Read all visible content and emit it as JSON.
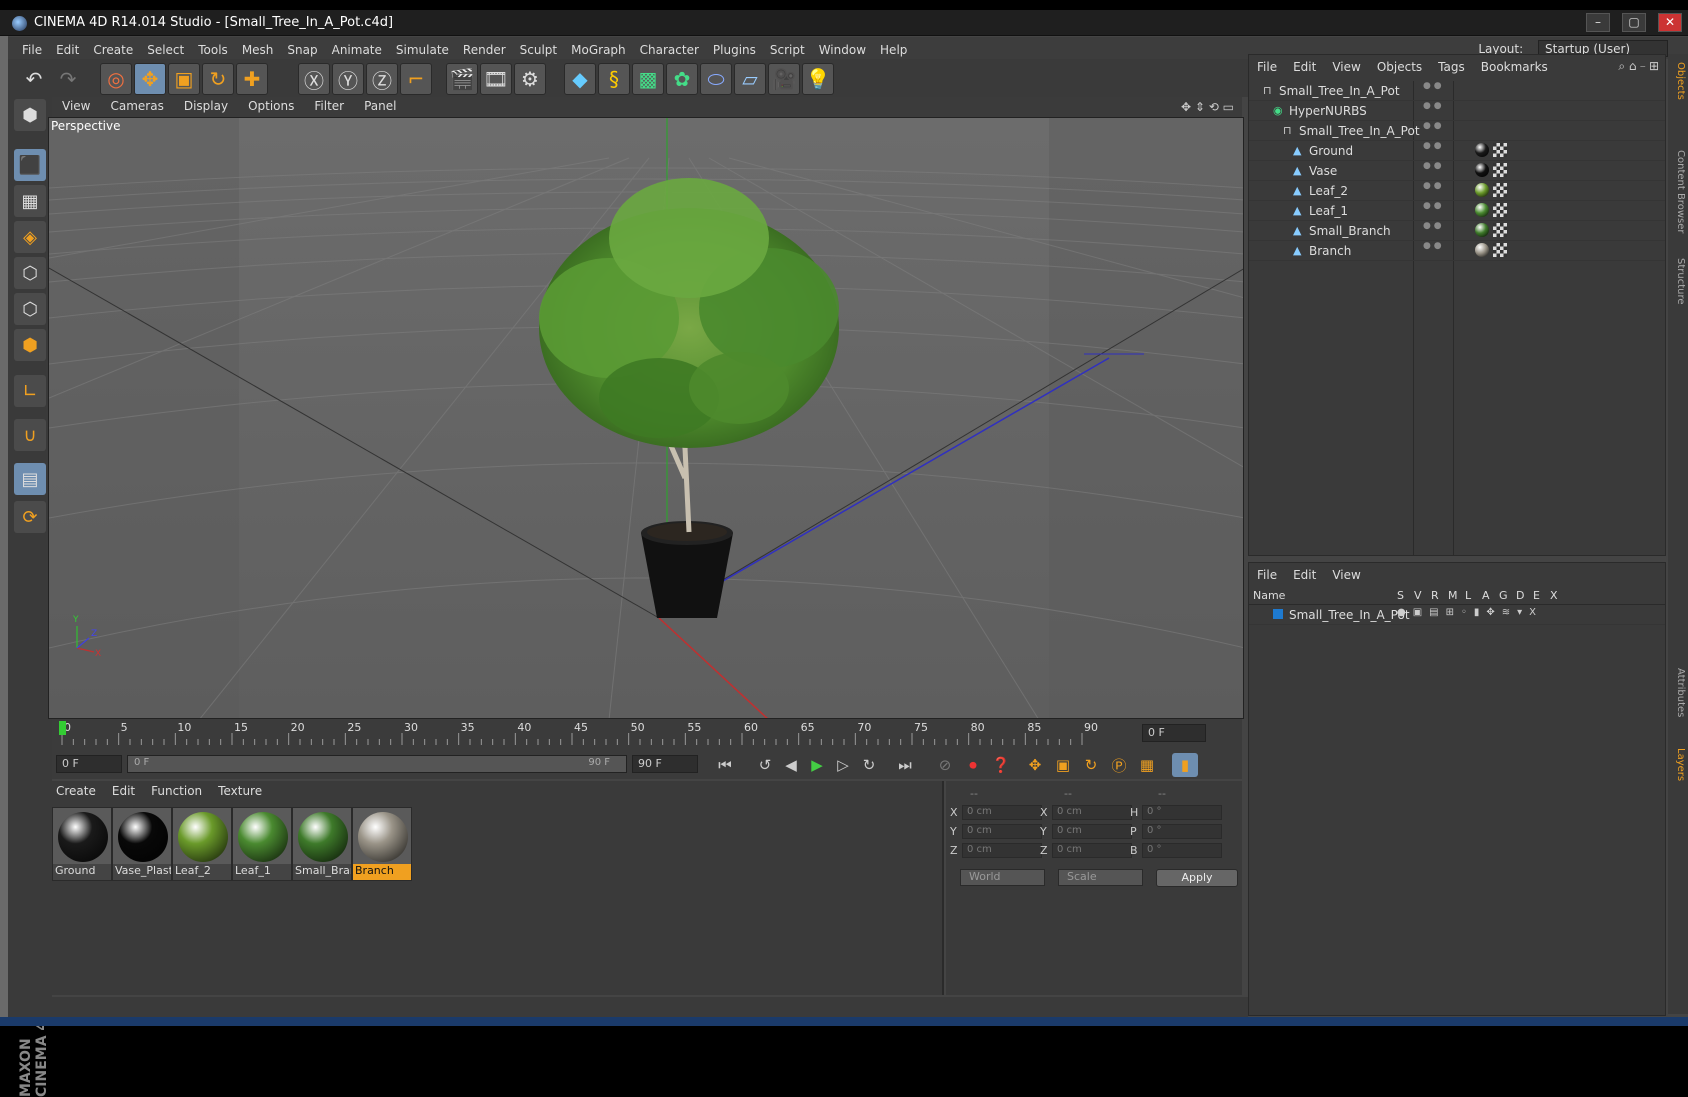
{
  "window": {
    "title": "CINEMA 4D R14.014 Studio - [Small_Tree_In_A_Pot.c4d]",
    "minimize": "–",
    "maximize": "▢",
    "close": "✕"
  },
  "menubar": {
    "items": [
      "File",
      "Edit",
      "Create",
      "Select",
      "Tools",
      "Mesh",
      "Snap",
      "Animate",
      "Simulate",
      "Render",
      "Sculpt",
      "MoGraph",
      "Character",
      "Plugins",
      "Script",
      "Window",
      "Help"
    ],
    "layout_label": "Layout:",
    "layout_value": "Startup (User)"
  },
  "viewport": {
    "menu": [
      "View",
      "Cameras",
      "Display",
      "Options",
      "Filter",
      "Panel"
    ],
    "label": "Perspective",
    "axis_x": "X",
    "axis_y": "Y",
    "axis_z": "Z"
  },
  "timeline": {
    "ticks": [
      "0",
      "5",
      "10",
      "15",
      "20",
      "25",
      "30",
      "35",
      "40",
      "45",
      "50",
      "55",
      "60",
      "65",
      "70",
      "75",
      "80",
      "85",
      "90"
    ],
    "current_frame": "0 F",
    "start_frame": "0 F",
    "range_start": "0 F",
    "range_end": "90 F",
    "end_frame": "90 F"
  },
  "material_panel": {
    "menu": [
      "Create",
      "Edit",
      "Function",
      "Texture"
    ],
    "materials": [
      {
        "name": "Ground",
        "color": "#1a1a1a"
      },
      {
        "name": "Vase_Plasti",
        "color": "#080808"
      },
      {
        "name": "Leaf_2",
        "color": "#6a9a2a"
      },
      {
        "name": "Leaf_1",
        "color": "#4a8a30"
      },
      {
        "name": "Small_Bran",
        "color": "#3e7a2a"
      },
      {
        "name": "Branch",
        "color": "#9a9488"
      }
    ],
    "selected": "Branch"
  },
  "coordinates": {
    "header": [
      "--",
      "--",
      "--"
    ],
    "rows": [
      {
        "l1": "X",
        "v1": "0 cm",
        "l2": "X",
        "v2": "0 cm",
        "l3": "H",
        "v3": "0 °"
      },
      {
        "l1": "Y",
        "v1": "0 cm",
        "l2": "Y",
        "v2": "0 cm",
        "l3": "P",
        "v3": "0 °"
      },
      {
        "l1": "Z",
        "v1": "0 cm",
        "l2": "Z",
        "v2": "0 cm",
        "l3": "B",
        "v3": "0 °"
      }
    ],
    "space": "World",
    "mode": "Scale",
    "apply": "Apply"
  },
  "object_manager": {
    "menu": [
      "File",
      "Edit",
      "View",
      "Objects",
      "Tags",
      "Bookmarks"
    ],
    "objects": [
      {
        "name": "Small_Tree_In_A_Pot",
        "indent": 0
      },
      {
        "name": "HyperNURBS",
        "indent": 1
      },
      {
        "name": "Small_Tree_In_A_Pot",
        "indent": 2
      },
      {
        "name": "Ground",
        "indent": 3,
        "mat": "#1a1a1a"
      },
      {
        "name": "Vase",
        "indent": 3,
        "mat": "#111111"
      },
      {
        "name": "Leaf_2",
        "indent": 3,
        "mat": "#6a9a2a"
      },
      {
        "name": "Leaf_1",
        "indent": 3,
        "mat": "#4a8a30"
      },
      {
        "name": "Small_Branch",
        "indent": 3,
        "mat": "#3e7a2a"
      },
      {
        "name": "Branch",
        "indent": 3,
        "mat": "#9a9488"
      }
    ]
  },
  "layer_manager": {
    "menu": [
      "File",
      "Edit",
      "View"
    ],
    "columns": [
      "Name",
      "S",
      "V",
      "R",
      "M",
      "L",
      "A",
      "G",
      "D",
      "E",
      "X"
    ],
    "rows": [
      {
        "name": "Small_Tree_In_A_Pot"
      }
    ]
  },
  "right_tabs": [
    "Objects",
    "Content Browser",
    "Structure",
    "Attributes",
    "Layers"
  ],
  "branding": "MAXON CINEMA 4D",
  "accent": "#f0a020"
}
